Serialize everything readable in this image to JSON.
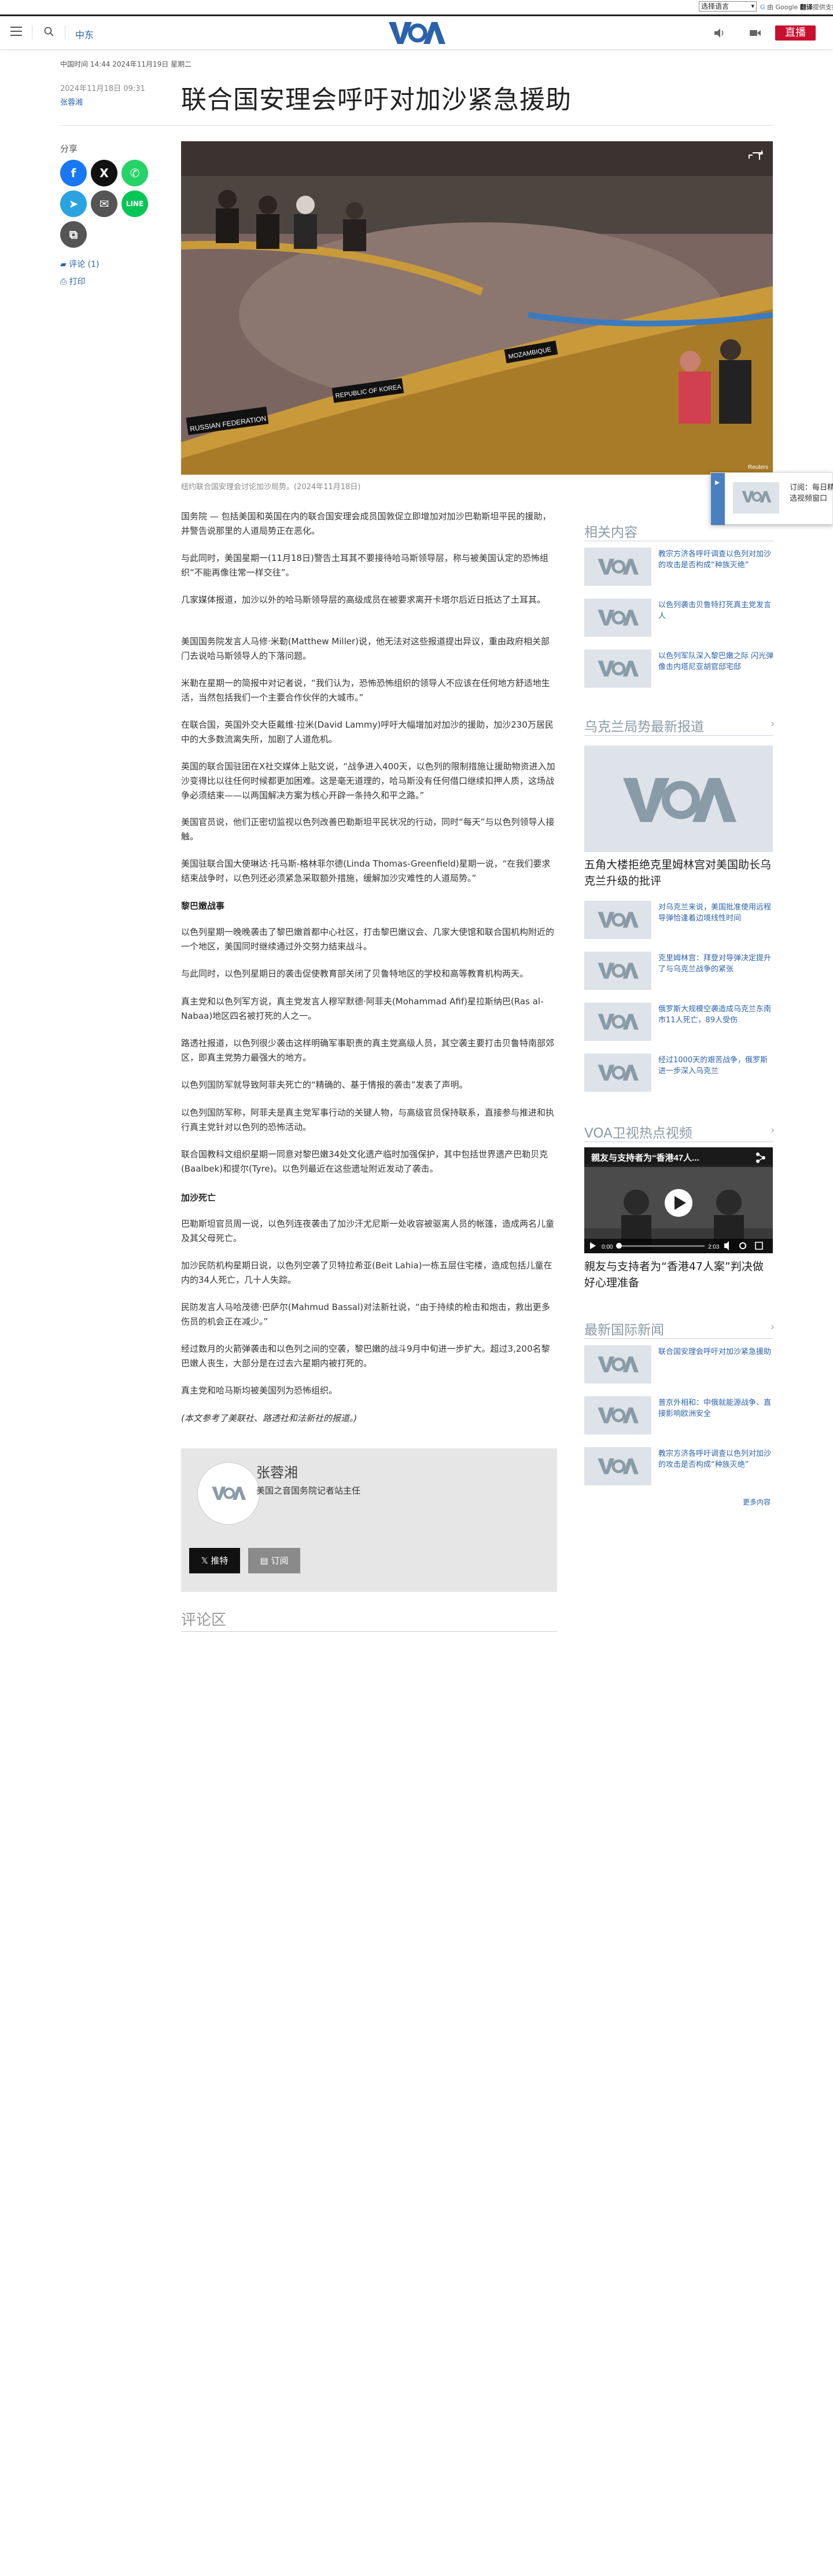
{
  "topbar": {
    "language_select": "选择语言",
    "translate_powered": "由 Google",
    "translate_brand": "翻译",
    "translate_suffix": "提供支持"
  },
  "header": {
    "category": "中东",
    "live_label": "直播",
    "logo_text": "VOA"
  },
  "article": {
    "dateline": "中国时间 14:44 2024年11月19日 星期二",
    "pub_date": "2024年11月18日 09:31",
    "byline": "张蓉湘",
    "title": "联合国安理会呼吁对加沙紧急援助",
    "caption": "纽约联合国安理会讨论加沙局势。(2024年11月18日)",
    "hero_labels": {
      "left": "RUSSIAN FEDERATION",
      "mid": "REPUBLIC OF KOREA",
      "right": "MOZAMBIQUE",
      "credit": "Reuters"
    },
    "paragraphs": [
      "国务院 — 包括美国和英国在内的联合国安理会成员国敦促立即增加对加沙巴勒斯坦平民的援助，并警告说那里的人道局势正在恶化。",
      "与此同时，美国星期一(11月18日)警告土耳其不要接待哈马斯领导层，称与被美国认定的恐怖组织“不能再像往常一样交往”。",
      "几家媒体报道，加沙以外的哈马斯领导层的高级成员在被要求离开卡塔尔后近日抵达了土耳其。",
      "美国国务院发言人马修·米勒(Matthew Miller)说，他无法对这些报道提出异议，重由政府相关部门去说哈马斯领导人的下落问题。",
      "米勒在星期一的简报中对记者说，“我们认为，恐怖恐怖组织的领导人不应该在任何地方舒适地生活，当然包括我们一个主要合作伙伴的大城市。”",
      "在联合国，英国外交大臣戴维·拉米(David Lammy)呼吁大幅增加对加沙的援助，加沙230万居民中的大多数流离失所，加剧了人道危机。",
      "英国的联合国驻团在X社交媒体上贴文说，“战争进入400天，以色列的限制措施让援助物资进入加沙变得比以往任何时候都更加困难。这是毫无道理的，哈马斯没有任何借口继续扣押人质，这场战争必须结束——以两国解决方案为核心开辟一条持久和平之路。”",
      "美国官员说，他们正密切监视以色列改善巴勒斯坦平民状况的行动，同时“每天”与以色列领导人接触。",
      "美国驻联合国大使琳达·托马斯-格林菲尔德(Linda Thomas-Greenfield)星期一说，“在我们要求结束战争时，以色列还必须紧急采取额外措施，缓解加沙灾难性的人道局势。”",
      "以色列星期一晚晚袭击了黎巴嫩首都中心社区，打击黎巴嫩议会、几家大使馆和联合国机构附近的一个地区，美国同时继续通过外交努力结束战斗。",
      "与此同时，以色列星期日的袭击促使教育部关闭了贝鲁特地区的学校和高等教育机构两天。",
      "真主党和以色列军方说，真主党发言人穆罕默德·阿菲夫(Mohammad Afif)星拉斯纳巴(Ras al-Nabaa)地区四名被打死的人之一。",
      "路透社报道，以色列很少袭击这样明确军事职责的真主党高级人员，其空袭主要打击贝鲁特南部郊区，即真主党势力最强大的地方。",
      "以色列国防军就导致阿菲夫死亡的“精确的、基于情报的袭击”发表了声明。",
      "以色列国防军称，阿菲夫是真主党军事行动的关键人物，与高级官员保持联系，直接参与推进和执行真主党针对以色列的恐怖活动。",
      "联合国教科文组织星期一同意对黎巴嫩34处文化遗产临时加强保护，其中包括世界遗产巴勒贝克(Baalbek)和提尔(Tyre)。以色列最近在这些遗址附近发动了袭击。",
      "巴勒斯坦官员周一说，以色列连夜袭击了加沙汗尤尼斯一处收容被驱离人员的帐篷，造成两名儿童及其父母死亡。",
      "加沙民防机构星期日说，以色列空袭了贝特拉希亚(Beit Lahia)一栋五层住宅楼，造成包括儿童在内的34人死亡，几十人失踪。",
      "民防发言人马哈茂德·巴萨尔(Mahmud Bassal)对法新社说，“由于持续的枪击和炮击，救出更多伤员的机会正在减少。”",
      "经过数月的火箭弹袭击和以色列之间的空袭，黎巴嫩的战斗9月中旬进一步扩大。超过3,200名黎巴嫩人丧生，大部分是在过去六星期内被打死的。",
      "真主党和哈马斯均被美国列为恐怖组织。",
      "(本文参考了美联社、路透社和法新社的报道。)"
    ],
    "subheads": [
      "黎巴嫩战事",
      "加沙死亡"
    ],
    "share_label": "分享",
    "comments_link": "评论 (1)",
    "print_link": "打印"
  },
  "author": {
    "name": "张蓉湘",
    "role": "美国之音国务院记者站主任",
    "tweet_label": "推特",
    "subscribe_label": "订阅"
  },
  "comments": {
    "heading": "评论区"
  },
  "sidebar": {
    "related_heading": "相关内容",
    "related": [
      "教宗方济各呼吁调查以色列对加沙的攻击是否构成“种族灭绝”",
      "以色列袭击贝鲁特打死真主党发言人",
      "以色列军队深入黎巴嫩之际 闪光弹像击内塔尼亚胡官邸宅邸"
    ],
    "ukraine_heading": "乌克兰局势最新报道",
    "ukraine_featured": "五角大楼拒绝克里姆林宫对美国助长乌克兰升级的批评",
    "ukraine": [
      "对乌克兰来说，美国批准使用远程导弹恰逢着边境线性时间",
      "克里姆林宫：拜登对导弹决定提升了与乌克兰战争的紧张",
      "俄罗斯大规模空袭造成乌克兰东南市11人死亡，89人受伤",
      "经过1000天的艰苦战争，俄罗斯进一步深入乌克兰"
    ],
    "video_heading": "VOA卫视热点视频",
    "video_overlay_title": "親友与支持者为“香港47人...",
    "video_time": "0:00",
    "video_duration": "2:03",
    "video_caption": "親友与支持者为“香港47人案”判决做好心理准备",
    "intl_heading": "最新国际新闻",
    "intl": [
      "联合国安理会呼吁对加沙紧急援助",
      "普京外相和：中俄就能源战争、直接影响欧洲安全",
      "教宗方济各呼吁调查以色列对加沙的攻击是否构成“种族灭绝”"
    ],
    "more_label": "更多内容"
  },
  "popup": {
    "text": "订阅：每日精选视频窗口"
  },
  "colors": {
    "accent_blue": "#2b62ad",
    "live_red": "#c8102e",
    "sidebar_heading": "#8a9ba8"
  }
}
